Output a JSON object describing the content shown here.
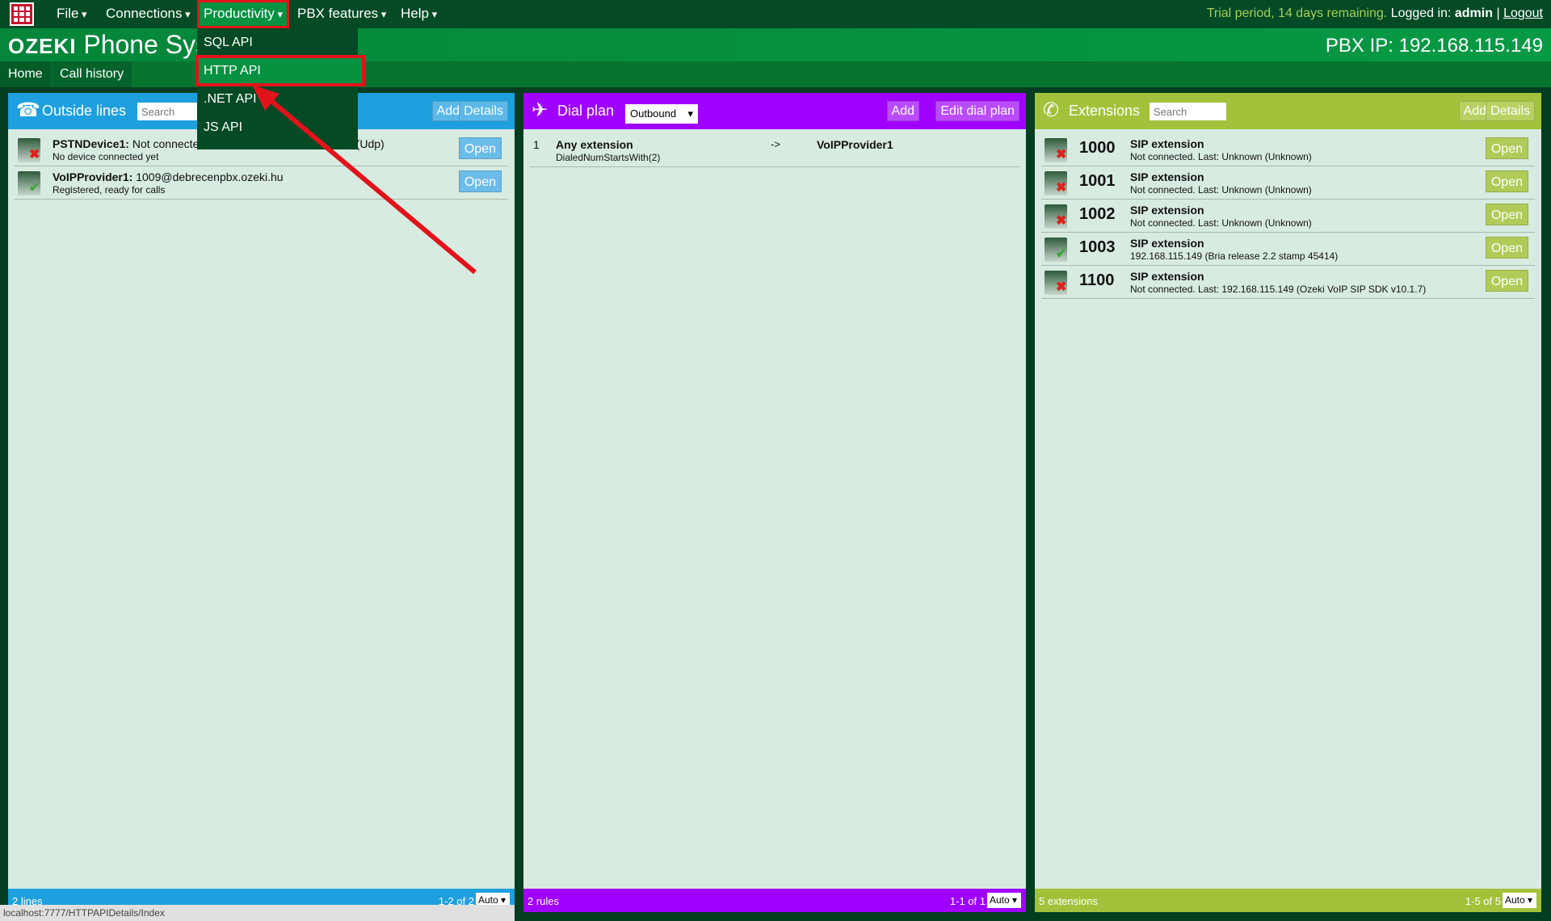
{
  "topbar": {
    "menus": [
      "File",
      "Connections",
      "Productivity",
      "PBX features",
      "Help"
    ],
    "trial": "Trial period, 14 days remaining.",
    "logged_in_label": "Logged in:",
    "user": "admin",
    "separator": "|",
    "logout": "Logout"
  },
  "header": {
    "brand_logo": "OZEKI",
    "brand_text": "Phone Sys",
    "pbx_ip": "PBX IP: 192.168.115.149"
  },
  "nav": {
    "home": "Home",
    "call_history": "Call history"
  },
  "dropdown": {
    "items": [
      "SQL API",
      "HTTP API",
      ".NET API",
      "JS API"
    ],
    "highlighted": "HTTP API"
  },
  "colors": {
    "outside_lines": "#1ea0df",
    "dial_plan": "#a000ff",
    "extensions": "#a3c23b",
    "highlight_border": "#e2131b"
  },
  "outside_lines": {
    "title": "Outside lines",
    "search_placeholder": "Search",
    "add": "Add",
    "details": "Details",
    "rows": [
      {
        "name": "PSTNDevice1:",
        "desc": "Not connecte",
        "desc_tail": "1 (Udp)",
        "sub": "No device connected yet",
        "status": "error",
        "open": "Open"
      },
      {
        "name": "VoIPProvider1:",
        "desc": "1009@debrecenpbx.ozeki.hu",
        "desc_tail": "",
        "sub": "Registered, ready for calls",
        "status": "ok",
        "open": "Open"
      }
    ],
    "footer_left": "2 lines",
    "footer_right": "1-2 of 2",
    "page_size": "Auto"
  },
  "dial_plan": {
    "title": "Dial plan",
    "direction": "Outbound",
    "add": "Add",
    "edit": "Edit dial plan",
    "rows": [
      {
        "index": "1",
        "source": "Any extension",
        "condition": "DialedNumStartsWith(2)",
        "arrow": "->",
        "target": "VoIPProvider1"
      }
    ],
    "footer_left": "2 rules",
    "footer_right": "1-1 of 1",
    "page_size": "Auto"
  },
  "extensions": {
    "title": "Extensions",
    "search_placeholder": "Search",
    "add": "Add",
    "details": "Details",
    "rows": [
      {
        "number": "1000",
        "type": "SIP extension",
        "sub": "Not connected. Last: Unknown (Unknown)",
        "status": "error",
        "open": "Open"
      },
      {
        "number": "1001",
        "type": "SIP extension",
        "sub": "Not connected. Last: Unknown (Unknown)",
        "status": "error",
        "open": "Open"
      },
      {
        "number": "1002",
        "type": "SIP extension",
        "sub": "Not connected. Last: Unknown (Unknown)",
        "status": "error",
        "open": "Open"
      },
      {
        "number": "1003",
        "type": "SIP extension",
        "sub": "192.168.115.149 (Bria release 2.2 stamp 45414)",
        "status": "ok",
        "open": "Open"
      },
      {
        "number": "1100",
        "type": "SIP extension",
        "sub": "Not connected. Last: 192.168.115.149 (Ozeki VoIP SIP SDK v10.1.7)",
        "status": "error",
        "open": "Open"
      }
    ],
    "footer_left": "5 extensions",
    "footer_right": "1-5 of 5",
    "page_size": "Auto"
  },
  "statusbar": {
    "url": "localhost:7777/HTTPAPIDetails/Index"
  }
}
